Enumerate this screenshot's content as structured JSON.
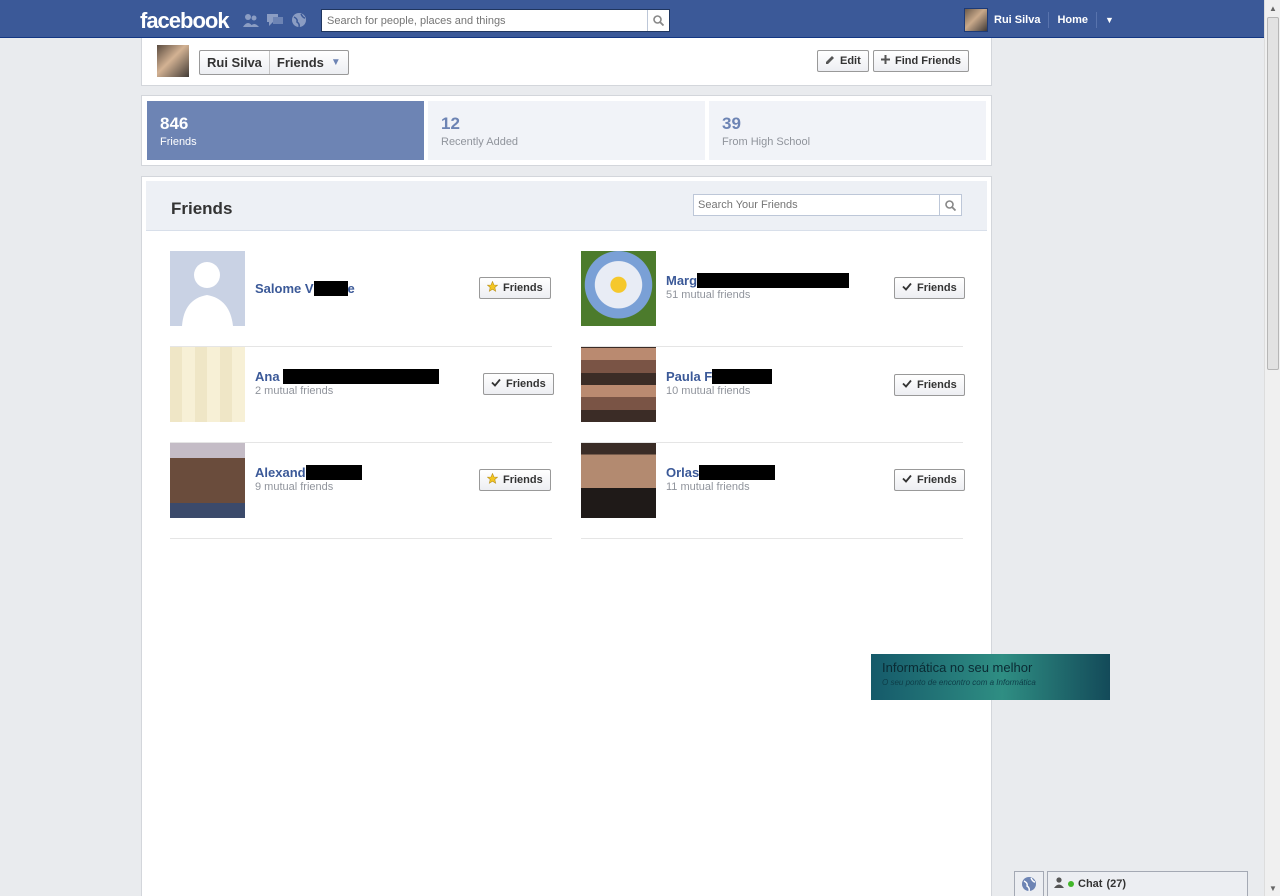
{
  "topbar": {
    "logo": "facebook",
    "search_placeholder": "Search for people, places and things",
    "user_name": "Rui Silva",
    "home": "Home"
  },
  "header": {
    "name": "Rui Silva",
    "section": "Friends",
    "edit": "Edit",
    "find_friends": "Find Friends"
  },
  "stats": [
    {
      "num": "846",
      "label": "Friends"
    },
    {
      "num": "12",
      "label": "Recently Added"
    },
    {
      "num": "39",
      "label": "From High School"
    }
  ],
  "friends_section": {
    "title": "Friends",
    "search_placeholder": "Search Your Friends"
  },
  "friends": [
    {
      "name_a": "Salome V",
      "name_b": "e",
      "mutual": "",
      "button": "Friends"
    },
    {
      "name_a": "Marg",
      "name_b": "",
      "mutual": "51 mutual friends",
      "button": "Friends"
    },
    {
      "name_a": "Ana ",
      "name_b": "",
      "mutual": "2 mutual friends",
      "button": "Friends"
    },
    {
      "name_a": "Paula F",
      "name_b": "",
      "mutual": "10 mutual friends",
      "button": "Friends"
    },
    {
      "name_a": "Alexand",
      "name_b": "",
      "mutual": "9 mutual friends",
      "button": "Friends"
    },
    {
      "name_a": "Orlas",
      "name_b": "",
      "mutual": "11 mutual friends",
      "button": "Friends"
    }
  ],
  "ad": {
    "title": "Informática no seu melhor",
    "subtitle": "O seu ponto de encontro com a Informática"
  },
  "chat": {
    "label": "Chat",
    "count": "(27)"
  },
  "colors": {
    "brand": "#3b5998",
    "active_tab": "#6d84b4"
  }
}
